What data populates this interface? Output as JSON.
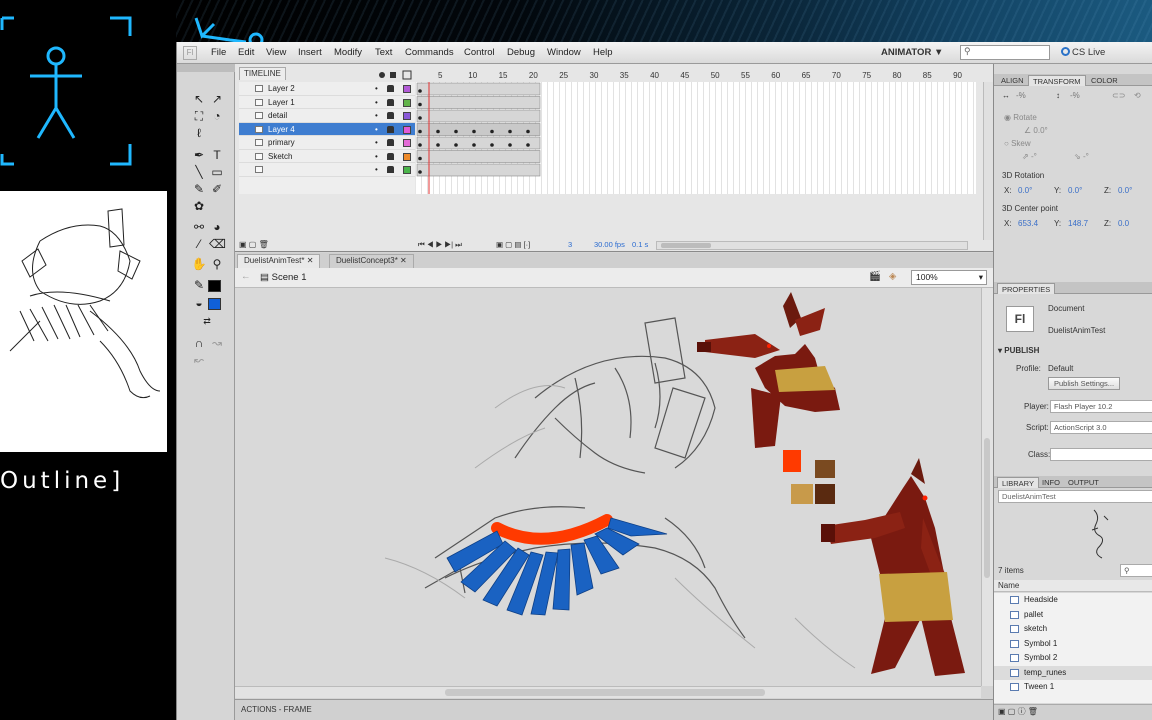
{
  "overlay": {
    "label": "Outline]"
  },
  "menu": {
    "items": [
      "File",
      "Edit",
      "View",
      "Insert",
      "Modify",
      "Text",
      "Commands",
      "Control",
      "Debug",
      "Window",
      "Help"
    ],
    "workspace": "ANIMATOR ▼",
    "cslive": "CS Live"
  },
  "timeline": {
    "tab": "TIMELINE",
    "ruler": [
      "5",
      "10",
      "15",
      "20",
      "25",
      "30",
      "35",
      "40",
      "45",
      "50",
      "55",
      "60",
      "65",
      "70",
      "75",
      "80",
      "85",
      "90"
    ],
    "layers": [
      {
        "name": "Layer 2",
        "color": "#b25ad6"
      },
      {
        "name": "Layer 1",
        "color": "#62b44a"
      },
      {
        "name": "detail",
        "color": "#8a59d8"
      },
      {
        "name": "Layer 4",
        "color": "#e05ad8",
        "selected": true
      },
      {
        "name": "primary",
        "color": "#e36ad6"
      },
      {
        "name": "Sketch",
        "color": "#ee8a2a"
      },
      {
        "name": "",
        "color": "#4ab44a"
      }
    ],
    "frame": "3",
    "fps": "30.00 fps",
    "time": "0.1 s"
  },
  "docs": {
    "tabs": [
      "DuelistAnimTest*",
      "DuelistConcept3*"
    ],
    "scene": "Scene 1",
    "zoom": "100%"
  },
  "actions": {
    "label": "ACTIONS - FRAME"
  },
  "transform": {
    "tabs": [
      "ALIGN",
      "TRANSFORM",
      "COLOR"
    ],
    "width_pct": "-%",
    "height_pct": "-%",
    "rotate": "Rotate",
    "rotate_val": "0.0°",
    "skew": "Skew",
    "skew_val1": "-°",
    "skew_val2": "-°",
    "rot3d": "3D Rotation",
    "x_label": "X:",
    "x_val": "0.0°",
    "y_label": "Y:",
    "y_val": "0.0°",
    "z_label": "Z:",
    "z_val": "0.0°",
    "center": "3D Center point",
    "cx_val": "653.4",
    "cy_val": "148.7",
    "cz_val": "0.0"
  },
  "properties": {
    "tab": "PROPERTIES",
    "doc_label": "Document",
    "doc_name": "DuelistAnimTest",
    "fl_icon": "Fl",
    "publish": "PUBLISH",
    "profile_label": "Profile:",
    "profile_val": "Default",
    "publish_settings": "Publish Settings...",
    "player_label": "Player:",
    "player_val": "Flash Player 10.2",
    "script_label": "Script:",
    "script_val": "ActionScript 3.0",
    "class_label": "Class:"
  },
  "library": {
    "tabs": [
      "LIBRARY",
      "INFO",
      "OUTPUT"
    ],
    "doc": "DuelistAnimTest",
    "count": "7 items",
    "name_header": "Name",
    "items": [
      "Headside",
      "pallet",
      "sketch",
      "Symbol 1",
      "Symbol 2",
      "temp_runes",
      "Tween 1"
    ]
  }
}
